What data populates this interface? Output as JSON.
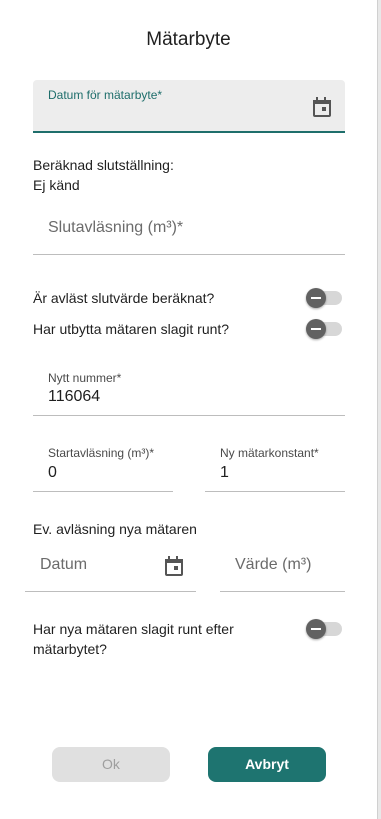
{
  "dialog": {
    "title": "Mätarbyte",
    "date_field": {
      "label": "Datum för mätarbyte*",
      "value": "",
      "icon": "calendar-icon"
    },
    "calculated_label": "Beräknad slutställning:",
    "calculated_value": "Ej känd",
    "final_reading_placeholder": "Slutavläsning (m³)*",
    "toggle_calculated": {
      "label": "Är avläst slutvärde beräknat?",
      "checked": false
    },
    "toggle_rollover_old": {
      "label": "Har utbytta mätaren slagit runt?",
      "checked": false
    },
    "new_number": {
      "label": "Nytt nummer*",
      "value": "116064"
    },
    "start_reading": {
      "label": "Startavläsning (m³)*",
      "value": "0"
    },
    "meter_constant": {
      "label": "Ny mätarkonstant*",
      "value": "1"
    },
    "new_reading_section": "Ev. avläsning nya mätaren",
    "new_reading_date_placeholder": "Datum",
    "new_reading_value_placeholder": "Värde (m³)",
    "toggle_rollover_new": {
      "label_line1": "Har nya mätaren slagit runt efter",
      "label_line2": "mätarbytet?",
      "checked": false
    },
    "ok_label": "Ok",
    "cancel_label": "Avbryt"
  },
  "colors": {
    "accent": "#1e7470",
    "field_fill": "#ededed",
    "disabled": "#e0e0e0"
  }
}
